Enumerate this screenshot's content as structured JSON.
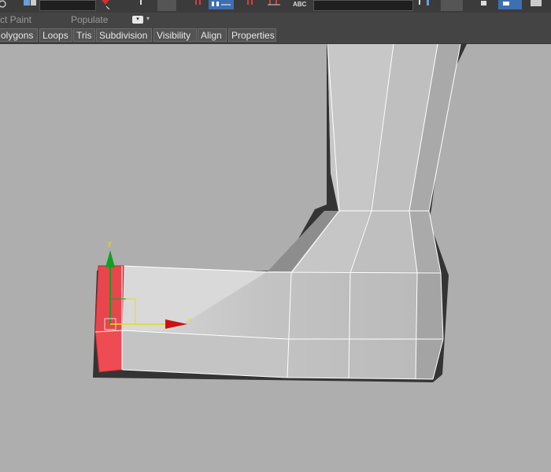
{
  "toolbar": {
    "abc_label": "ABC"
  },
  "ribbon": {
    "object_paint_label": "ct Paint",
    "populate_label": "Populate"
  },
  "tabs": [
    {
      "label": "olygons"
    },
    {
      "label": "Loops"
    },
    {
      "label": "Tris"
    },
    {
      "label": "Subdivision"
    },
    {
      "label": "Visibility"
    },
    {
      "label": "Align"
    },
    {
      "label": "Properties"
    }
  ],
  "gizmo": {
    "x_label": "x",
    "y_label": "y"
  },
  "colors": {
    "viewport_bg": "#aeaeae",
    "selected_face": "#e8434a",
    "gizmo_x": "#e01010",
    "gizmo_y": "#10a020",
    "wire": "#ffffff"
  }
}
